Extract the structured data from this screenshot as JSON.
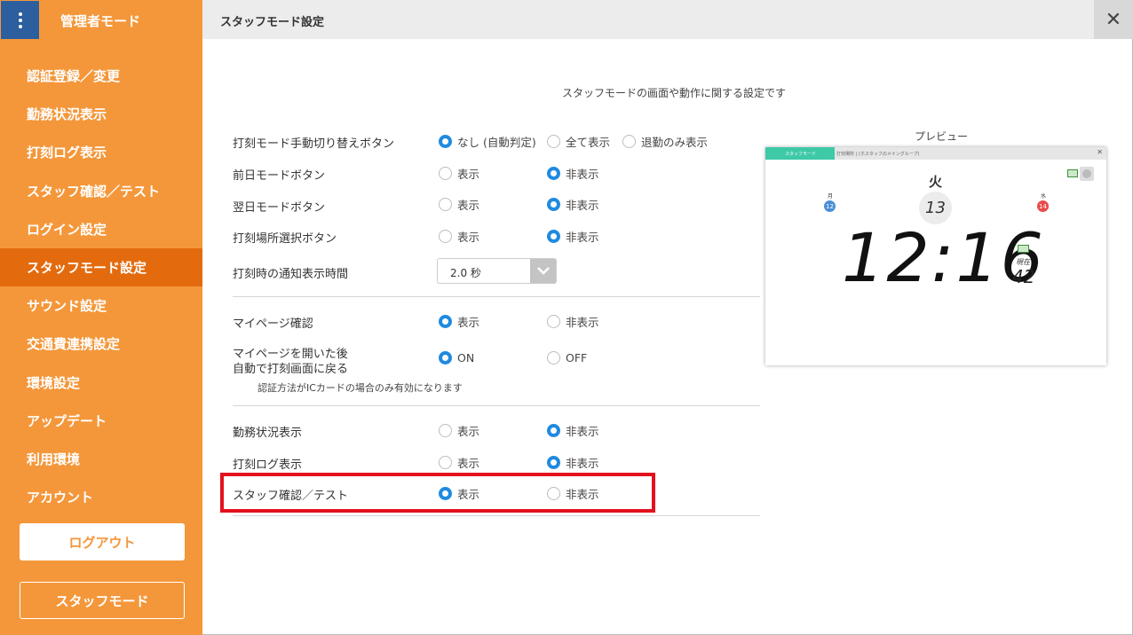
{
  "sidebar": {
    "title": "管理者モード",
    "items": [
      {
        "label": "認証登録／変更",
        "active": false
      },
      {
        "label": "勤務状況表示",
        "active": false
      },
      {
        "label": "打刻ログ表示",
        "active": false
      },
      {
        "label": "スタッフ確認／テスト",
        "active": false
      },
      {
        "label": "ログイン設定",
        "active": false
      },
      {
        "label": "スタッフモード設定",
        "active": true
      },
      {
        "label": "サウンド設定",
        "active": false
      },
      {
        "label": "交通費連携設定",
        "active": false
      },
      {
        "label": "環境設定",
        "active": false
      },
      {
        "label": "アップデート",
        "active": false
      },
      {
        "label": "利用環境",
        "active": false
      },
      {
        "label": "アカウント",
        "active": false
      }
    ],
    "logout_label": "ログアウト",
    "staff_mode_label": "スタッフモード"
  },
  "header": {
    "title": "スタッフモード設定",
    "close_glyph": "✕"
  },
  "main": {
    "description": "スタッフモードの画面や動作に関する設定です",
    "settings": [
      {
        "label": "打刻モード手動切り替えボタン",
        "options": [
          "なし (自動判定)",
          "全て表示",
          "退勤のみ表示"
        ],
        "selected": 0
      },
      {
        "label": "前日モードボタン",
        "options": [
          "表示",
          "非表示"
        ],
        "selected": 1
      },
      {
        "label": "翌日モードボタン",
        "options": [
          "表示",
          "非表示"
        ],
        "selected": 1
      },
      {
        "label": "打刻場所選択ボタン",
        "options": [
          "表示",
          "非表示"
        ],
        "selected": 1
      },
      {
        "label": "打刻時の通知表示時間",
        "select_value": "2.0 秒"
      },
      {
        "label": "マイページ確認",
        "options": [
          "表示",
          "非表示"
        ],
        "selected": 0
      },
      {
        "label_line1": "マイページを開いた後",
        "label_line2": "自動で打刻画面に戻る",
        "options": [
          "ON",
          "OFF"
        ],
        "selected": 0,
        "note": "認証方法がICカードの場合のみ有効になります"
      },
      {
        "label": "勤務状況表示",
        "options": [
          "表示",
          "非表示"
        ],
        "selected": 1
      },
      {
        "label": "打刻ログ表示",
        "options": [
          "表示",
          "非表示"
        ],
        "selected": 1
      },
      {
        "label": "スタッフ確認／テスト",
        "options": [
          "表示",
          "非表示"
        ],
        "selected": 0
      }
    ]
  },
  "preview": {
    "label": "プレビュー",
    "tab_label": "スタッフモード",
    "tabs_rest": "打刻場所 | (ホスタッフのメイングループ)",
    "close_glyph": "✕",
    "day_of_week": "火",
    "prev_day_label": "月",
    "prev_day": "12",
    "today": "13",
    "next_day_label": "水",
    "next_day": "14",
    "time": "12:16",
    "now_label": "現在",
    "seconds": "42",
    "accent_color": "#3ec9a7"
  },
  "colors": {
    "sidebar_bg": "#f4973a",
    "sidebar_active": "#e36b0e",
    "menu_button": "#2d5f9e",
    "radio_checked": "#1f8ae0",
    "highlight": "#e3121d"
  }
}
